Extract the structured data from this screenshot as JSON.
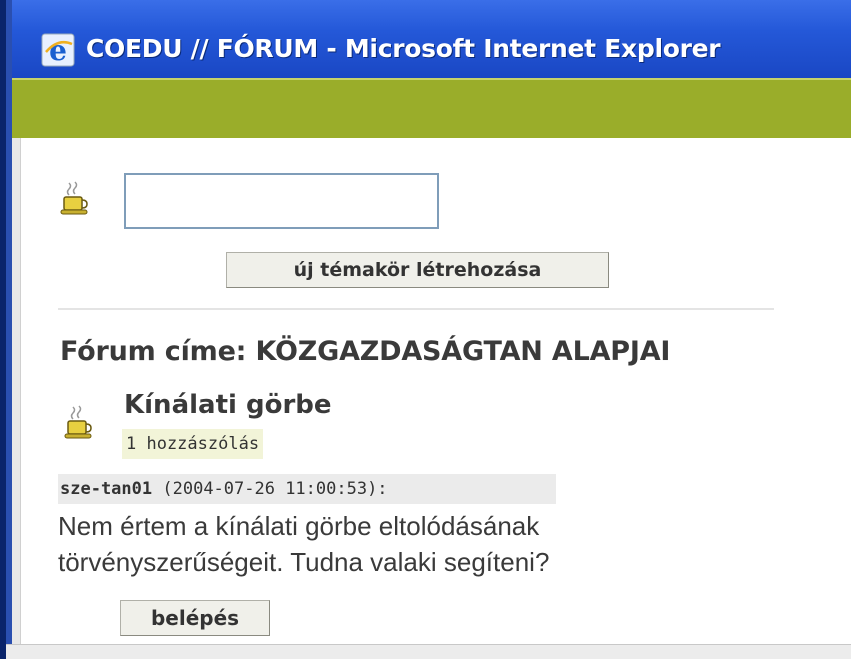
{
  "window": {
    "title": "COEDU // FÓRUM - Microsoft Internet Explorer"
  },
  "new_topic": {
    "input_value": "",
    "button_label": "új témakör létrehozása"
  },
  "forum": {
    "title": "Fórum címe: KÖZGAZDASÁGTAN ALAPJAI"
  },
  "topic": {
    "title": "Kínálati görbe",
    "reply_count": "1 hozzászólás"
  },
  "post": {
    "author": "sze-tan01",
    "timestamp": "(2004-07-26 11:00:53):",
    "body": "Nem értem a kínálati görbe eltolódásának törvényszerűségeit. Tudna valaki segíteni?"
  },
  "login": {
    "button_label": "belépés"
  },
  "colors": {
    "titlebar": "#2458d8",
    "greenbar": "#9aad2a",
    "reply_badge": "#f2f4d8"
  },
  "icons": [
    "ie-icon",
    "coffee-cup-icon"
  ]
}
